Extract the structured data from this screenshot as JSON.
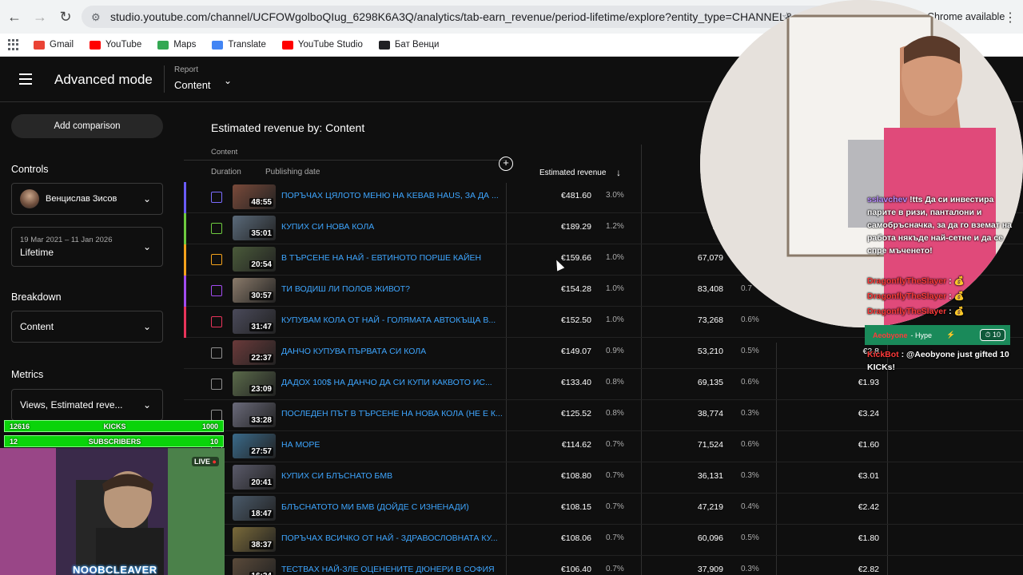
{
  "browser": {
    "url": "studio.youtube.com/channel/UCFOWgolboQIug_6298K6A3Q/analytics/tab-earn_revenue/period-lifetime/explore?entity_type=CHANNEL&entity_id=...",
    "chrome_badge": "Chrome available",
    "bookmarks": [
      {
        "label": "Gmail",
        "color": "#ea4335"
      },
      {
        "label": "YouTube",
        "color": "#ff0000"
      },
      {
        "label": "Maps",
        "color": "#34a853"
      },
      {
        "label": "Translate",
        "color": "#4285f4"
      },
      {
        "label": "YouTube Studio",
        "color": "#ff0000"
      },
      {
        "label": "Бат Венци",
        "color": "#202124"
      }
    ]
  },
  "header": {
    "title": "Advanced mode",
    "report_label": "Report",
    "report_value": "Content"
  },
  "sidebar": {
    "add_comparison": "Add comparison",
    "controls_title": "Controls",
    "channel_name": "Венцислав Зисов",
    "date_range": "19 Mar 2021 – 11 Jan 2026",
    "period": "Lifetime",
    "breakdown_title": "Breakdown",
    "breakdown_value": "Content",
    "metrics_title": "Metrics",
    "metrics_value": "Views, Estimated reve..."
  },
  "table": {
    "title": "Estimated revenue by: Content",
    "content_header": "Content",
    "duration_header": "Duration",
    "publishing_header": "Publishing date",
    "revenue_header": "Estimated revenue",
    "rows": [
      {
        "accent": "#6a5cff",
        "cb_color": "#7b6cff",
        "thumb": "#7a4a3a",
        "duration": "48:55",
        "title": "ПОРЪЧАХ ЦЯЛОТО МЕНЮ НА KEBAB HAUS, ЗА ДА ...",
        "revenue": "€481.60",
        "pct": "3.0%",
        "views": "16",
        "vpct": "",
        "rpm": ""
      },
      {
        "accent": "#6ecb3f",
        "cb_color": "#6ecb3f",
        "thumb": "#5a6a7a",
        "duration": "35:01",
        "title": "КУПИХ СИ НОВА КОЛА",
        "revenue": "€189.29",
        "pct": "1.2%",
        "views": "75,",
        "vpct": "",
        "rpm": ""
      },
      {
        "accent": "#f4a21c",
        "cb_color": "#f4a21c",
        "thumb": "#4a5a3a",
        "duration": "20:54",
        "title": "В ТЪРСЕНЕ НА НАЙ - ЕВТИНОТО ПОРШЕ КАЙЕН",
        "revenue": "€159.66",
        "pct": "1.0%",
        "views": "67,079",
        "vpct": "",
        "rpm": ""
      },
      {
        "accent": "#a24cf0",
        "cb_color": "#a24cf0",
        "thumb": "#8a7a6a",
        "duration": "30:57",
        "title": "ТИ ВОДИШ ЛИ ПОЛОВ ЖИВОТ?",
        "revenue": "€154.28",
        "pct": "1.0%",
        "views": "83,408",
        "vpct": "0.7",
        "rpm": ""
      },
      {
        "accent": "#e8345a",
        "cb_color": "#e8345a",
        "thumb": "#4a4a5a",
        "duration": "31:47",
        "title": "КУПУВАМ КОЛА ОТ НАЙ - ГОЛЯМАТА АВТОКЪЩА В...",
        "revenue": "€152.50",
        "pct": "1.0%",
        "views": "73,268",
        "vpct": "0.6%",
        "rpm": ""
      },
      {
        "accent": "",
        "cb_color": "#909090",
        "thumb": "#6a3a3a",
        "duration": "22:37",
        "title": "ДАНЧО КУПУВА ПЪРВАТА СИ КОЛА",
        "revenue": "€149.07",
        "pct": "0.9%",
        "views": "53,210",
        "vpct": "0.5%",
        "rpm": "€2.8"
      },
      {
        "accent": "",
        "cb_color": "#909090",
        "thumb": "#5a6a4a",
        "duration": "23:09",
        "title": "ДАДОХ 100$ НА ДАНЧО ДА СИ КУПИ КАКВОТО ИС...",
        "revenue": "€133.40",
        "pct": "0.8%",
        "views": "69,135",
        "vpct": "0.6%",
        "rpm": "€1.93"
      },
      {
        "accent": "",
        "cb_color": "#909090",
        "thumb": "#6a6a7a",
        "duration": "33:28",
        "title": "ПОСЛЕДЕН ПЪТ В ТЪРСЕНЕ НА НОВА КОЛА (НЕ Е К...",
        "revenue": "€125.52",
        "pct": "0.8%",
        "views": "38,774",
        "vpct": "0.3%",
        "rpm": "€3.24"
      },
      {
        "accent": "",
        "cb_color": "#909090",
        "thumb": "#3a6a8a",
        "duration": "27:57",
        "title": "НА МОРЕ",
        "revenue": "€114.62",
        "pct": "0.7%",
        "views": "71,524",
        "vpct": "0.6%",
        "rpm": "€1.60"
      },
      {
        "accent": "",
        "cb_color": "#909090",
        "thumb": "#5a5a6a",
        "duration": "20:41",
        "title": "КУПИХ СИ БЛЪСНАТО БМВ",
        "revenue": "€108.80",
        "pct": "0.7%",
        "views": "36,131",
        "vpct": "0.3%",
        "rpm": "€3.01"
      },
      {
        "accent": "",
        "cb_color": "#909090",
        "thumb": "#4a5a6a",
        "duration": "18:47",
        "title": "БЛЪСНАТОТО МИ БМВ (ДОЙДЕ С ИЗНЕНАДИ)",
        "revenue": "€108.15",
        "pct": "0.7%",
        "views": "47,219",
        "vpct": "0.4%",
        "rpm": "€2.42"
      },
      {
        "accent": "",
        "cb_color": "#909090",
        "thumb": "#7a6a3a",
        "duration": "38:37",
        "title": "ПОРЪЧАХ ВСИЧКО ОТ НАЙ - ЗДРАВОСЛОВНАТА КУ...",
        "revenue": "€108.06",
        "pct": "0.7%",
        "views": "60,096",
        "vpct": "0.5%",
        "rpm": "€1.80"
      },
      {
        "accent": "",
        "cb_color": "#909090",
        "thumb": "#5a4a3a",
        "duration": "16:24",
        "title": "ТЕСТВАХ НАЙ-ЗЛЕ ОЦЕНЕНИТЕ ДЮНЕРИ В СОФИЯ",
        "revenue": "€106.40",
        "pct": "0.7%",
        "views": "37,909",
        "vpct": "0.3%",
        "rpm": "€2.82"
      }
    ]
  },
  "stream": {
    "chat": [
      {
        "name": "sslavchev",
        "name_color": "#b98cff",
        "text": "!tts Да си инвестира парите в ризи, панталони и самобръсначка, за да го вземат на работа някъде най-сетне и да се спре мъченето!"
      },
      {
        "name": "DragonflyTheSlayer",
        "name_color": "#ff3a3a",
        "text": ": 💰"
      },
      {
        "name": "DragonflyTheSlayer",
        "name_color": "#ff3a3a",
        "text": ": 💰"
      },
      {
        "name": "DragonflyTheSlayer",
        "name_color": "#ff3a3a",
        "text": ": 💰"
      },
      {
        "name": "KickBot",
        "name_color": "#ff3a3a",
        "text": ": @Aeobyone just gifted 10 KICKs!"
      }
    ],
    "hype_user": "Aeobyone",
    "hype_label": "- Hype",
    "hype_amount": "10",
    "goals": [
      {
        "left": "12616",
        "center": "KICKS",
        "right": "1000"
      },
      {
        "left": "12",
        "center": "SUBSCRIBERS",
        "right": "10"
      }
    ],
    "live_label": "LIVE",
    "streamer": "NOOBCLEAVER"
  }
}
